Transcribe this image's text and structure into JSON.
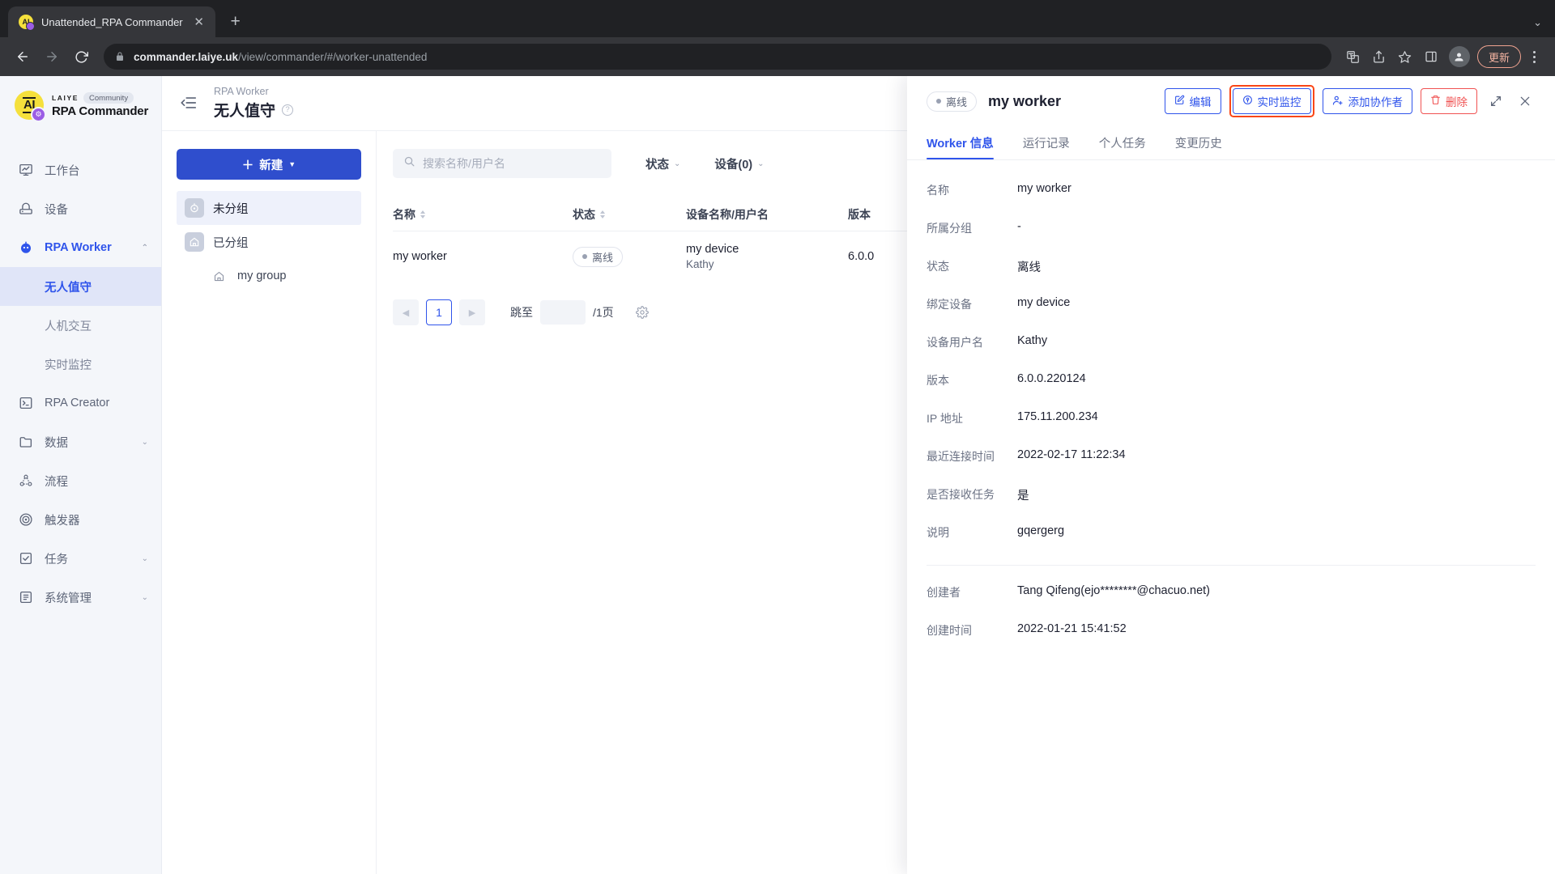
{
  "browser": {
    "tab": {
      "title": "Unattended_RPA Commander",
      "favicon": "laiye-ai-icon",
      "close": "✕"
    },
    "newtab_label": "+",
    "window_caret": "⌄",
    "url": {
      "host": "commander.laiye.uk",
      "path": "/view/commander/#/worker-unattended"
    },
    "update_label": "更新"
  },
  "sidebar": {
    "brand": {
      "logo_text": "AI",
      "laiye": "LAIYE",
      "community": "Community",
      "name": "RPA Commander"
    },
    "items": [
      {
        "label": "工作台",
        "icon": "dashboard-icon",
        "chevron": ""
      },
      {
        "label": "设备",
        "icon": "device-icon",
        "chevron": ""
      },
      {
        "label": "RPA Worker",
        "icon": "robot-icon",
        "chevron": "⌃"
      },
      {
        "label": "RPA Creator",
        "icon": "terminal-icon",
        "chevron": ""
      },
      {
        "label": "数据",
        "icon": "folder-icon",
        "chevron": "⌄"
      },
      {
        "label": "流程",
        "icon": "flow-icon",
        "chevron": ""
      },
      {
        "label": "触发器",
        "icon": "trigger-icon",
        "chevron": ""
      },
      {
        "label": "任务",
        "icon": "task-icon",
        "chevron": "⌄"
      },
      {
        "label": "系统管理",
        "icon": "system-icon",
        "chevron": "⌄"
      }
    ],
    "subitems": [
      {
        "label": "无人值守",
        "active": true
      },
      {
        "label": "人机交互",
        "active": false
      },
      {
        "label": "实时监控",
        "active": false
      }
    ]
  },
  "header": {
    "collapse_icon": "collapse-sidebar-icon",
    "breadcrumb_parent": "RPA Worker",
    "title": "无人值守",
    "help": "?"
  },
  "groups": {
    "new_label": "新建",
    "new_plus": "＋",
    "new_caret": "▼",
    "tree": [
      {
        "label": "未分组",
        "icon": "robot-group-icon",
        "selected": true,
        "sub": false
      },
      {
        "label": "已分组",
        "icon": "grouped-icon",
        "selected": false,
        "sub": false
      },
      {
        "label": "my group",
        "icon": "group-node-icon",
        "selected": false,
        "sub": true
      }
    ]
  },
  "filters": {
    "search_placeholder": "搜索名称/用户名",
    "status_label": "状态",
    "device_label": "设备(0)",
    "caret": "⌄"
  },
  "table": {
    "columns": [
      {
        "label": "名称",
        "sortable": true
      },
      {
        "label": "状态",
        "sortable": true
      },
      {
        "label": "设备名称/用户名",
        "sortable": false
      },
      {
        "label": "版本",
        "sortable": false
      }
    ],
    "rows": [
      {
        "name": "my worker",
        "status": "离线",
        "device_name": "my device",
        "device_user": "Kathy",
        "version": "6.0.0"
      }
    ]
  },
  "pagination": {
    "prev": "◀",
    "next": "▶",
    "current": "1",
    "jump_label": "跳至",
    "jump_value": "",
    "total_label": "/1页",
    "settings_icon": "gear-icon"
  },
  "drawer": {
    "status_pill": "离线",
    "title": "my worker",
    "buttons": [
      {
        "label": "编辑",
        "icon": "edit-icon",
        "style": "primary",
        "highlighted": false
      },
      {
        "label": "实时监控",
        "icon": "monitor-icon",
        "style": "primary",
        "highlighted": true
      },
      {
        "label": "添加协作者",
        "icon": "add-user-icon",
        "style": "primary",
        "highlighted": false
      },
      {
        "label": "删除",
        "icon": "trash-icon",
        "style": "danger",
        "highlighted": false
      }
    ],
    "expand_icon": "expand-icon",
    "close_icon": "close-icon",
    "tabs": [
      {
        "label": "Worker 信息",
        "active": true
      },
      {
        "label": "运行记录",
        "active": false
      },
      {
        "label": "个人任务",
        "active": false
      },
      {
        "label": "变更历史",
        "active": false
      }
    ],
    "fields": [
      {
        "label": "名称",
        "value": "my worker"
      },
      {
        "label": "所属分组",
        "value": "-"
      },
      {
        "label": "状态",
        "value": "离线"
      },
      {
        "label": "绑定设备",
        "value": "my device"
      },
      {
        "label": "设备用户名",
        "value": "Kathy"
      },
      {
        "label": "版本",
        "value": "6.0.0.220124"
      },
      {
        "label": "IP 地址",
        "value": "175.11.200.234"
      },
      {
        "label": "最近连接时间",
        "value": "2022-02-17 11:22:34"
      },
      {
        "label": "是否接收任务",
        "value": "是"
      },
      {
        "label": "说明",
        "value": "gqergerg"
      }
    ],
    "meta_fields": [
      {
        "label": "创建者",
        "value": "Tang Qifeng(ejo********@chacuo.net)"
      },
      {
        "label": "创建时间",
        "value": "2022-01-21 15:41:52"
      }
    ]
  },
  "colors": {
    "brand_blue": "#2f54eb",
    "button_blue": "#2f4ecd",
    "danger_red": "#f05252",
    "highlight_orange": "#fa4616",
    "logo_yellow": "#f5e03c"
  }
}
